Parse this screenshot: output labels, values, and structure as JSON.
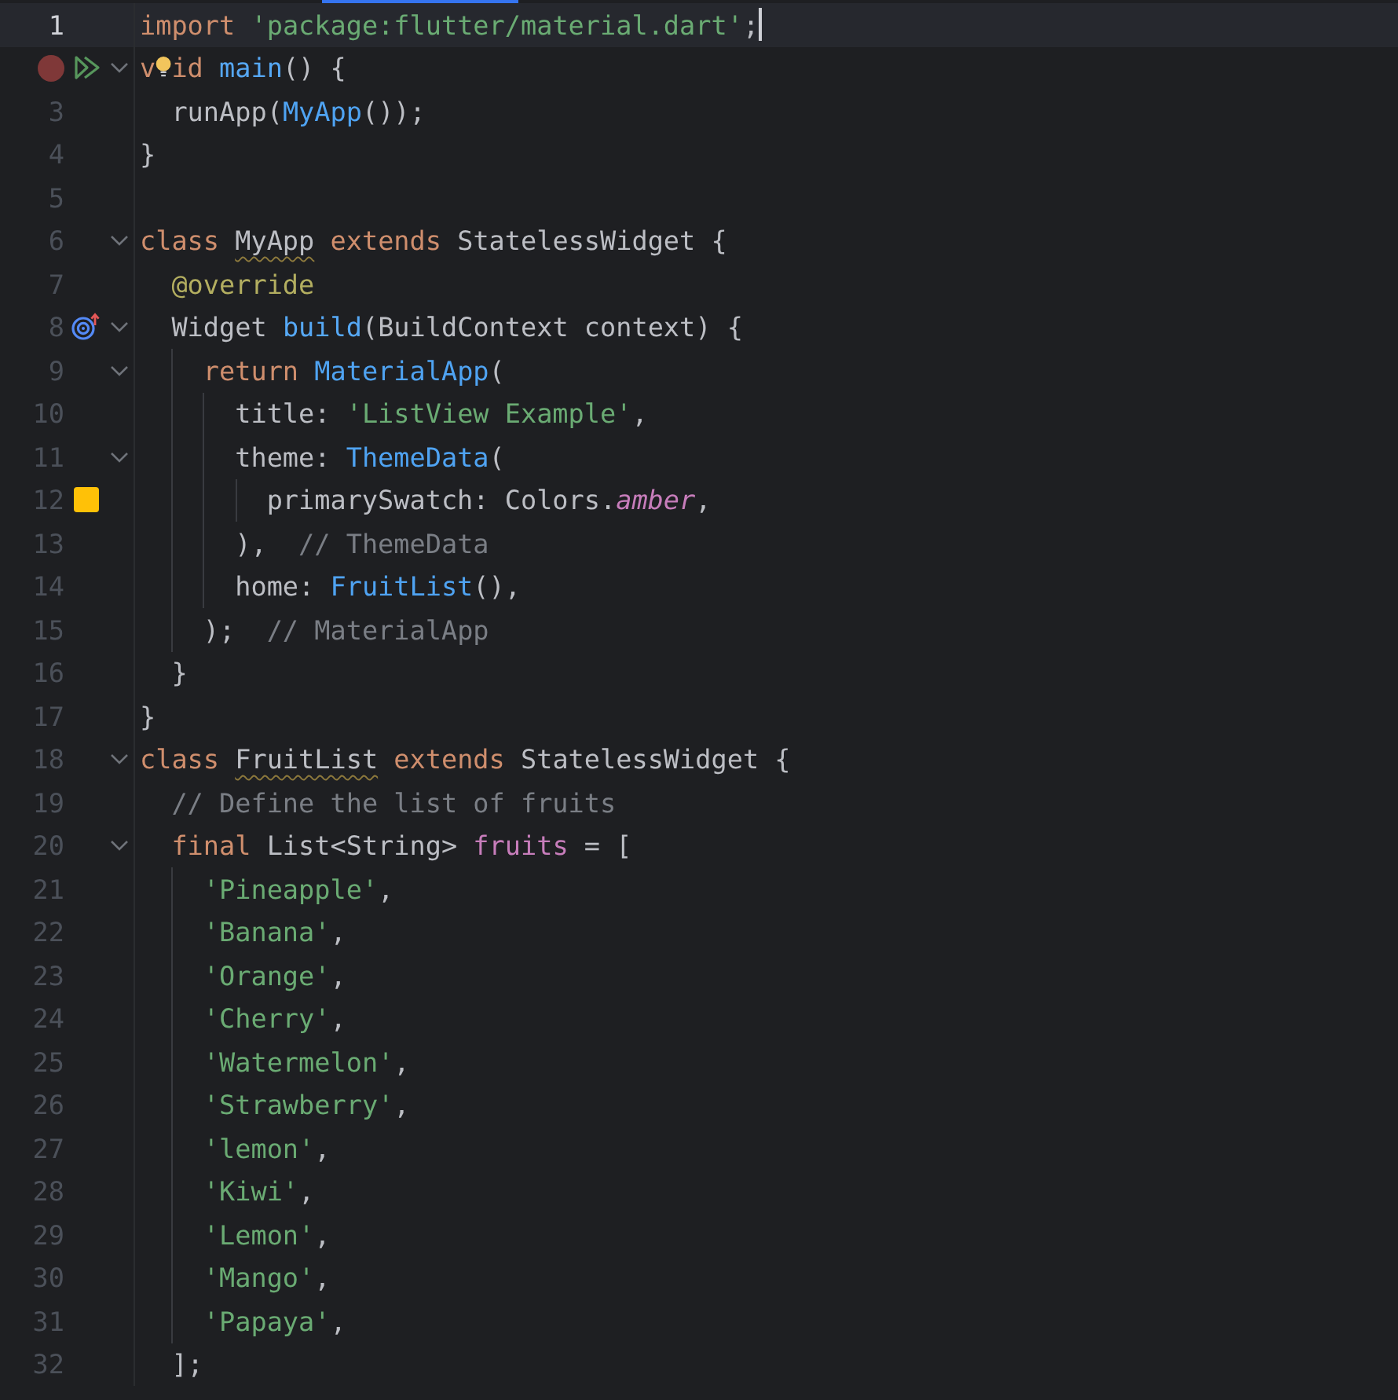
{
  "editor": {
    "lines": [
      {
        "number": "1",
        "current": true,
        "foldable": false,
        "tokens": [
          {
            "kind": "keyword",
            "text": "import "
          },
          {
            "kind": "string",
            "text": "'package:flutter/material.dart'"
          },
          {
            "kind": "plain",
            "text": ";"
          }
        ]
      },
      {
        "current": false,
        "foldable": true,
        "markers": [
          {
            "kind": "breakpoint"
          },
          {
            "kind": "run"
          }
        ],
        "tokens": [
          {
            "kind": "keyword",
            "text": "v"
          },
          {
            "kind": "bulb"
          },
          {
            "kind": "keyword",
            "text": "id "
          },
          {
            "kind": "function",
            "text": "main"
          },
          {
            "kind": "plain",
            "text": "() {"
          }
        ]
      },
      {
        "number": "3",
        "current": false,
        "foldable": false,
        "tokens": [
          {
            "kind": "plain",
            "text": "  runApp("
          },
          {
            "kind": "type",
            "text": "MyApp"
          },
          {
            "kind": "plain",
            "text": "());"
          }
        ]
      },
      {
        "number": "4",
        "current": false,
        "foldable": false,
        "tokens": [
          {
            "kind": "plain",
            "text": "}"
          }
        ]
      },
      {
        "number": "5",
        "current": false,
        "foldable": false
      },
      {
        "number": "6",
        "current": false,
        "foldable": true,
        "tokens": [
          {
            "kind": "keyword",
            "text": "class "
          },
          {
            "kind": "warning",
            "text": "MyApp"
          },
          {
            "kind": "keyword",
            "text": " extends "
          },
          {
            "kind": "plain",
            "text": "StatelessWidget {"
          }
        ]
      },
      {
        "number": "7",
        "current": false,
        "foldable": false,
        "tokens": [
          {
            "kind": "annotation",
            "text": "  @override"
          }
        ]
      },
      {
        "number": "8",
        "current": false,
        "foldable": true,
        "markers": [
          {
            "kind": "override"
          }
        ],
        "tokens": [
          {
            "kind": "plain",
            "text": "  Widget "
          },
          {
            "kind": "function",
            "text": "build"
          },
          {
            "kind": "plain",
            "text": "(BuildContext context) {"
          }
        ]
      },
      {
        "number": "9",
        "current": false,
        "foldable": true,
        "tokens": [
          {
            "kind": "keyword",
            "text": "    return "
          },
          {
            "kind": "type",
            "text": "MaterialApp"
          },
          {
            "kind": "plain",
            "text": "("
          }
        ]
      },
      {
        "number": "10",
        "current": false,
        "foldable": false,
        "tokens": [
          {
            "kind": "plain",
            "text": "      title: "
          },
          {
            "kind": "string",
            "text": "'ListView Example'"
          },
          {
            "kind": "plain",
            "text": ","
          }
        ]
      },
      {
        "number": "11",
        "current": false,
        "foldable": true,
        "tokens": [
          {
            "kind": "plain",
            "text": "      theme: "
          },
          {
            "kind": "type",
            "text": "ThemeData"
          },
          {
            "kind": "plain",
            "text": "("
          }
        ]
      },
      {
        "number": "12",
        "current": false,
        "foldable": false,
        "markers": [
          {
            "kind": "swatch",
            "color": "#ffc107"
          }
        ],
        "tokens": [
          {
            "kind": "plain",
            "text": "        primarySwatch: Colors."
          },
          {
            "kind": "constant",
            "text": "amber"
          },
          {
            "kind": "plain",
            "text": ","
          }
        ]
      },
      {
        "number": "13",
        "current": false,
        "foldable": false,
        "tokens": [
          {
            "kind": "plain",
            "text": "      ),  "
          },
          {
            "kind": "comment",
            "text": "// ThemeData"
          }
        ]
      },
      {
        "number": "14",
        "current": false,
        "foldable": false,
        "tokens": [
          {
            "kind": "plain",
            "text": "      home: "
          },
          {
            "kind": "type",
            "text": "FruitList"
          },
          {
            "kind": "plain",
            "text": "(),"
          }
        ]
      },
      {
        "number": "15",
        "current": false,
        "foldable": false,
        "tokens": [
          {
            "kind": "plain",
            "text": "    );  "
          },
          {
            "kind": "comment",
            "text": "// MaterialApp"
          }
        ]
      },
      {
        "number": "16",
        "current": false,
        "foldable": false,
        "tokens": [
          {
            "kind": "plain",
            "text": "  }"
          }
        ]
      },
      {
        "number": "17",
        "current": false,
        "foldable": false,
        "tokens": [
          {
            "kind": "plain",
            "text": "}"
          }
        ]
      },
      {
        "number": "18",
        "current": false,
        "foldable": true,
        "tokens": [
          {
            "kind": "keyword",
            "text": "class "
          },
          {
            "kind": "warning",
            "text": "FruitList"
          },
          {
            "kind": "keyword",
            "text": " extends "
          },
          {
            "kind": "plain",
            "text": "StatelessWidget {"
          }
        ]
      },
      {
        "number": "19",
        "current": false,
        "foldable": false,
        "tokens": [
          {
            "kind": "comment",
            "text": "  // Define the list of fruits"
          }
        ]
      },
      {
        "number": "20",
        "current": false,
        "foldable": true,
        "tokens": [
          {
            "kind": "keyword",
            "text": "  final "
          },
          {
            "kind": "plain",
            "text": "List<String> "
          },
          {
            "kind": "field",
            "text": "fruits"
          },
          {
            "kind": "plain",
            "text": " = ["
          }
        ]
      },
      {
        "number": "21",
        "current": false,
        "foldable": false,
        "tokens": [
          {
            "kind": "string",
            "text": "    'Pineapple'"
          },
          {
            "kind": "plain",
            "text": ","
          }
        ]
      },
      {
        "number": "22",
        "current": false,
        "foldable": false,
        "tokens": [
          {
            "kind": "string",
            "text": "    'Banana'"
          },
          {
            "kind": "plain",
            "text": ","
          }
        ]
      },
      {
        "number": "23",
        "current": false,
        "foldable": false,
        "tokens": [
          {
            "kind": "string",
            "text": "    'Orange'"
          },
          {
            "kind": "plain",
            "text": ","
          }
        ]
      },
      {
        "number": "24",
        "current": false,
        "foldable": false,
        "tokens": [
          {
            "kind": "string",
            "text": "    'Cherry'"
          },
          {
            "kind": "plain",
            "text": ","
          }
        ]
      },
      {
        "number": "25",
        "current": false,
        "foldable": false,
        "tokens": [
          {
            "kind": "string",
            "text": "    'Watermelon'"
          },
          {
            "kind": "plain",
            "text": ","
          }
        ]
      },
      {
        "number": "26",
        "current": false,
        "foldable": false,
        "tokens": [
          {
            "kind": "string",
            "text": "    'Strawberry'"
          },
          {
            "kind": "plain",
            "text": ","
          }
        ]
      },
      {
        "number": "27",
        "current": false,
        "foldable": false,
        "tokens": [
          {
            "kind": "string",
            "text": "    'lemon'"
          },
          {
            "kind": "plain",
            "text": ","
          }
        ]
      },
      {
        "number": "28",
        "current": false,
        "foldable": false,
        "tokens": [
          {
            "kind": "string",
            "text": "    'Kiwi'"
          },
          {
            "kind": "plain",
            "text": ","
          }
        ]
      },
      {
        "number": "29",
        "current": false,
        "foldable": false,
        "tokens": [
          {
            "kind": "string",
            "text": "    'Lemon'"
          },
          {
            "kind": "plain",
            "text": ","
          }
        ]
      },
      {
        "number": "30",
        "current": false,
        "foldable": false,
        "tokens": [
          {
            "kind": "string",
            "text": "    'Mango'"
          },
          {
            "kind": "plain",
            "text": ","
          }
        ]
      },
      {
        "number": "31",
        "current": false,
        "foldable": false,
        "tokens": [
          {
            "kind": "string",
            "text": "    'Papaya'"
          },
          {
            "kind": "plain",
            "text": ","
          }
        ]
      },
      {
        "number": "32",
        "current": false,
        "foldable": false,
        "tokens": [
          {
            "kind": "plain",
            "text": "  ];"
          }
        ]
      }
    ]
  }
}
